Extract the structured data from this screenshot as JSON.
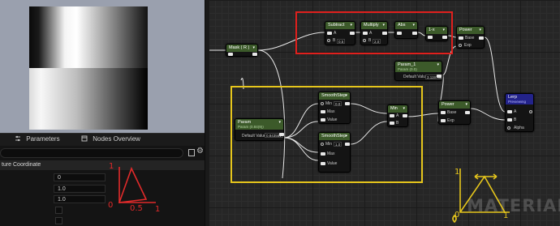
{
  "left_panel": {
    "tabs": [
      {
        "label": "Parameters",
        "icon": "sliders-icon"
      },
      {
        "label": "Nodes Overview",
        "icon": "nodes-icon"
      }
    ],
    "section_title": "ture Coordinate",
    "properties": [
      {
        "value": "0"
      },
      {
        "value": "1.0"
      },
      {
        "value": "1.0"
      }
    ],
    "sketch": {
      "y_label": "1",
      "x_labels": [
        "0",
        "0.5",
        "1"
      ],
      "color": "#e02a2a"
    }
  },
  "graph": {
    "nodes": {
      "mask": {
        "title": "Mask ( R )"
      },
      "subtract": {
        "title": "Subtract",
        "a": "A",
        "b": "B",
        "b_value": "0.5"
      },
      "multiply": {
        "title": "Multiply",
        "a": "A",
        "b": "B",
        "b_value": "2.0"
      },
      "abs": {
        "title": "Abs"
      },
      "one_minus": {
        "title": "1-x"
      },
      "power_top": {
        "title": "Power",
        "base": "Base",
        "exp": "Exp"
      },
      "param_1": {
        "title": "Param_1",
        "subtitle": "Param (0.0)",
        "default_label": "Default Value",
        "default_value": "3.119788"
      },
      "param": {
        "title": "Param",
        "subtitle": "Param (0.84(9))",
        "default_label": "Default Value",
        "default_value": "0.843581"
      },
      "smoothstep_top": {
        "title": "SmoothStep",
        "min": "Min",
        "min_value": "0.0",
        "max": "Max",
        "value": "Value"
      },
      "smoothstep_bottom": {
        "title": "SmoothStep",
        "min": "Min",
        "min_value": "1.0",
        "max": "Max",
        "value": "Value"
      },
      "min": {
        "title": "Min",
        "a": "A",
        "b": "B"
      },
      "power_mid": {
        "title": "Power",
        "base": "Base",
        "exp": "Exp"
      },
      "lerp": {
        "title": "Lerp",
        "subtitle": "Previewing",
        "a": "A",
        "b": "B",
        "alpha": "Alpha"
      }
    },
    "watermark": "MATERIAL",
    "sketch": {
      "y_label": "1",
      "x_labels": [
        "0",
        "1"
      ],
      "color": "#e6c61c"
    },
    "highlight_colors": {
      "red": "#e0201d",
      "yellow": "#e6c61c"
    }
  }
}
